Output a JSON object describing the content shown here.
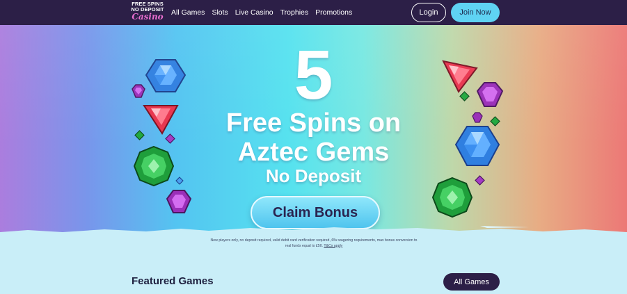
{
  "header": {
    "logo": {
      "line1": "FREE SPINS",
      "line2": "NO DEPOSIT",
      "line3": "Casino"
    },
    "nav": [
      "All Games",
      "Slots",
      "Live Casino",
      "Trophies",
      "Promotions"
    ],
    "login_label": "Login",
    "join_label": "Join Now"
  },
  "hero": {
    "number": "5",
    "line1": "Free Spins on",
    "line2": "Aztec Gems",
    "line3": "No Deposit",
    "cta_label": "Claim Bonus"
  },
  "disclaimer": {
    "line1": "New players only, no deposit required, valid debit card verification required, 65x wagering requirements, max bonus conversion to",
    "line2": "real funds equal to £50.",
    "tc_link": "T&Cs apply"
  },
  "featured": {
    "title": "Featured Games",
    "all_games_label": "All Games"
  },
  "colors": {
    "nav_bg": "#2c1f47",
    "join_button": "#5fd3f3",
    "lower_bg": "#c9eef8",
    "gem_blue": "#2f7fe0",
    "gem_red": "#e8354e",
    "gem_green": "#21a83f",
    "gem_purple": "#9a2fb8"
  }
}
